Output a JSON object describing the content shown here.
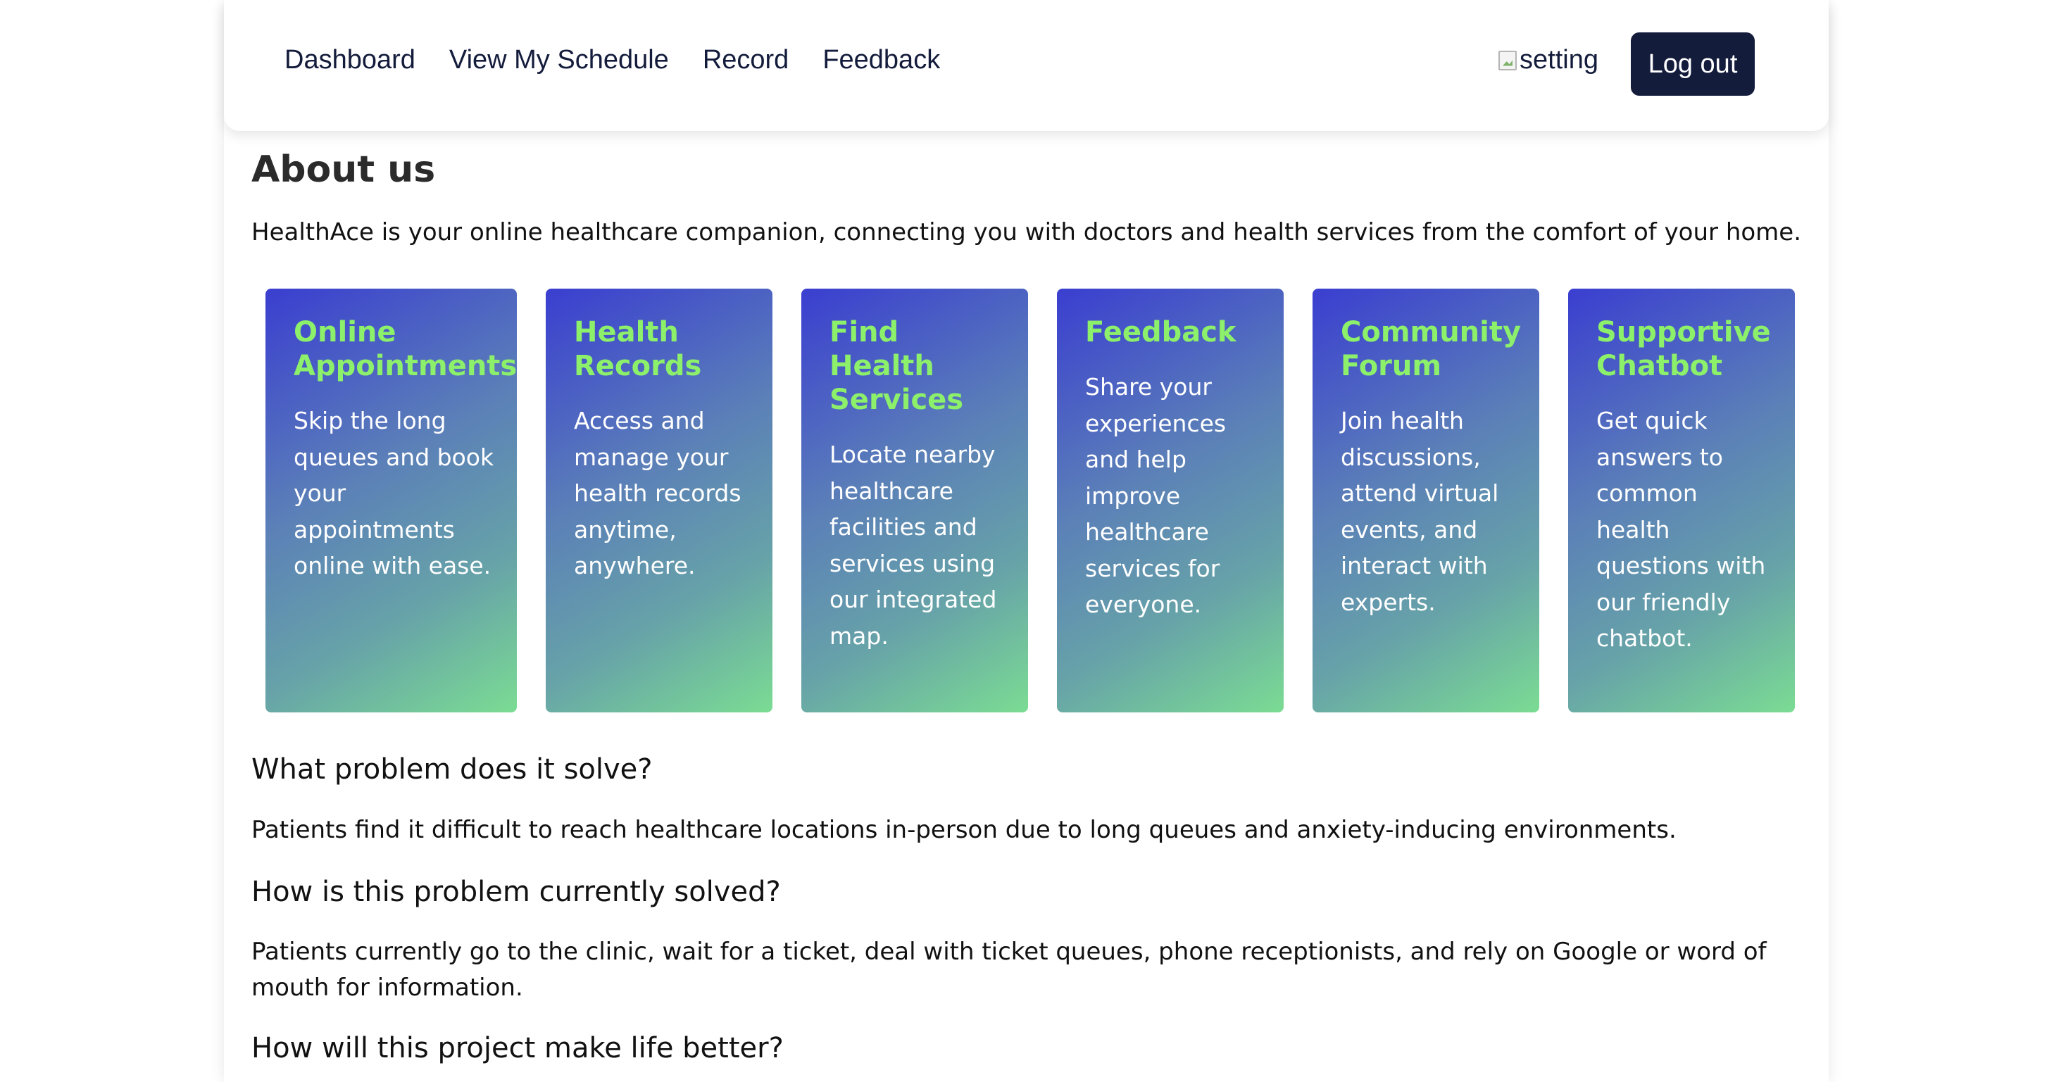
{
  "nav": {
    "links": [
      "Dashboard",
      "View My Schedule",
      "Record",
      "Feedback"
    ],
    "setting_alt": "setting",
    "logout_label": "Log out"
  },
  "about": {
    "heading": "About us",
    "intro": "HealthAce is your online healthcare companion, connecting you with doctors and health services from the comfort of your home."
  },
  "cards": [
    {
      "title": "Online Appointments",
      "text": "Skip the long queues and book your appointments online with ease."
    },
    {
      "title": "Health Records",
      "text": "Access and manage your health records anytime, anywhere."
    },
    {
      "title": "Find Health Services",
      "text": "Locate nearby healthcare facilities and services using our integrated map."
    },
    {
      "title": "Feedback",
      "text": "Share your experiences and help improve healthcare services for everyone."
    },
    {
      "title": "Community Forum",
      "text": "Join health discussions, attend virtual events, and interact with experts."
    },
    {
      "title": "Supportive Chatbot",
      "text": "Get quick answers to common health questions with our friendly chatbot."
    }
  ],
  "sections": {
    "problem_q": "What problem does it solve?",
    "problem_a": "Patients find it difficult to reach healthcare locations in-person due to long queues and anxiety-inducing environments.",
    "current_q": "How is this problem currently solved?",
    "current_a": "Patients currently go to the clinic, wait for a ticket, deal with ticket queues, phone receptionists, and rely on Google or word of mouth for information.",
    "better_q": "How will this project make life better?"
  },
  "colors": {
    "nav_text": "#141c3c",
    "logout_bg": "#141c3c",
    "card_title": "#8cf06a",
    "card_gradient_start": "#3a3ed0",
    "card_gradient_end": "#7bdc93"
  }
}
